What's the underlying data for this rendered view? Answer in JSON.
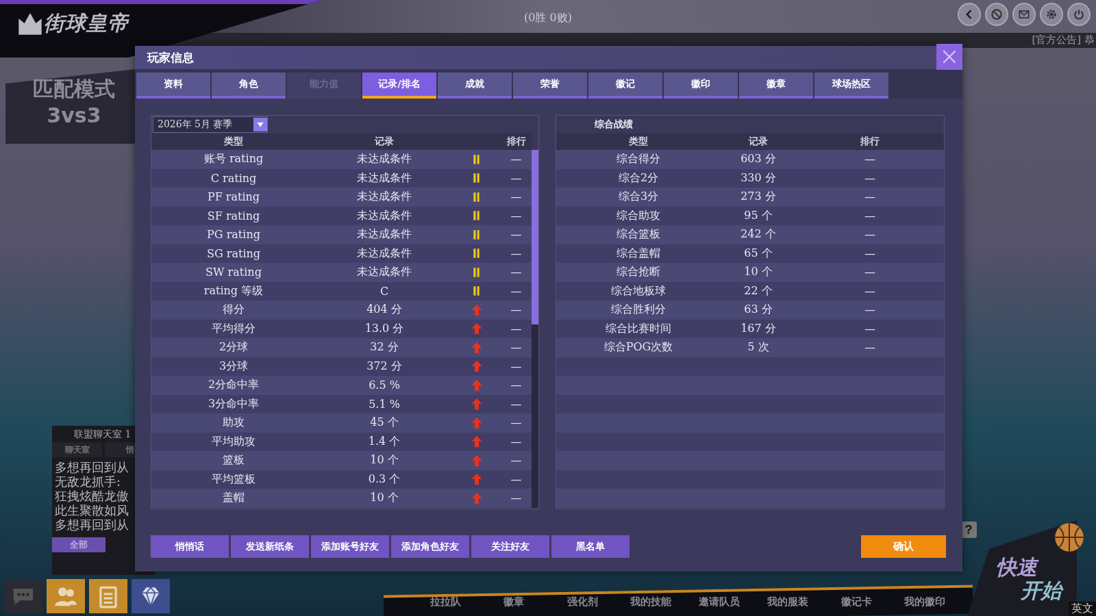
{
  "top_bar": {
    "logo": "街球皇帝",
    "record": "(0胜 0败)",
    "announcement": "[官方公告] 恭"
  },
  "mode": {
    "name": "匹配模式",
    "format": "3vs3"
  },
  "chat": {
    "title": "联盟聊天室 1",
    "tabs": [
      "聊天室",
      "悄"
    ],
    "messages": [
      "多想再回到从",
      "无敌龙抓手:",
      "狂拽炫酷龙傲",
      "此生聚散如风",
      "多想再回到从"
    ],
    "filter_button": "全部"
  },
  "dialog": {
    "title": "玩家信息",
    "tabs": [
      {
        "label": "资料",
        "selected": false,
        "disabled": false
      },
      {
        "label": "角色",
        "selected": false,
        "disabled": false
      },
      {
        "label": "能力值",
        "selected": false,
        "disabled": true
      },
      {
        "label": "记录/排名",
        "selected": true,
        "disabled": false
      },
      {
        "label": "成就",
        "selected": false,
        "disabled": false
      },
      {
        "label": "荣誉",
        "selected": false,
        "disabled": false
      },
      {
        "label": "徽记",
        "selected": false,
        "disabled": false
      },
      {
        "label": "徽印",
        "selected": false,
        "disabled": false
      },
      {
        "label": "徽章",
        "selected": false,
        "disabled": false
      },
      {
        "label": "球场热区",
        "selected": false,
        "disabled": false
      }
    ],
    "season": "2026年 5月 赛季",
    "season_table": {
      "columns": [
        "类型",
        "记录",
        "排行"
      ],
      "rows": [
        {
          "type": "账号 rating",
          "record": "未达成条件",
          "kind": "steady",
          "rank": "—"
        },
        {
          "type": "C rating",
          "record": "未达成条件",
          "kind": "steady",
          "rank": "—"
        },
        {
          "type": "PF rating",
          "record": "未达成条件",
          "kind": "steady",
          "rank": "—"
        },
        {
          "type": "SF rating",
          "record": "未达成条件",
          "kind": "steady",
          "rank": "—"
        },
        {
          "type": "PG rating",
          "record": "未达成条件",
          "kind": "steady",
          "rank": "—"
        },
        {
          "type": "SG rating",
          "record": "未达成条件",
          "kind": "steady",
          "rank": "—"
        },
        {
          "type": "SW rating",
          "record": "未达成条件",
          "kind": "steady",
          "rank": "—"
        },
        {
          "type": "rating 等级",
          "record": "C",
          "kind": "steady",
          "rank": "—"
        },
        {
          "type": "得分",
          "record": "404 分",
          "kind": "up",
          "rank": "—"
        },
        {
          "type": "平均得分",
          "record": "13.0 分",
          "kind": "up",
          "rank": "—"
        },
        {
          "type": "2分球",
          "record": "32 分",
          "kind": "up",
          "rank": "—"
        },
        {
          "type": "3分球",
          "record": "372 分",
          "kind": "up",
          "rank": "—"
        },
        {
          "type": "2分命中率",
          "record": "6.5 %",
          "kind": "up",
          "rank": "—"
        },
        {
          "type": "3分命中率",
          "record": "5.1 %",
          "kind": "up",
          "rank": "—"
        },
        {
          "type": "助攻",
          "record": "45 个",
          "kind": "up",
          "rank": "—"
        },
        {
          "type": "平均助攻",
          "record": "1.4 个",
          "kind": "up",
          "rank": "—"
        },
        {
          "type": "篮板",
          "record": "10 个",
          "kind": "up",
          "rank": "—"
        },
        {
          "type": "平均篮板",
          "record": "0.3 个",
          "kind": "up",
          "rank": "—"
        },
        {
          "type": "盖帽",
          "record": "10 个",
          "kind": "up",
          "rank": "—"
        }
      ]
    },
    "overall": {
      "title": "综合战绩",
      "columns": [
        "类型",
        "记录",
        "排行"
      ],
      "rows": [
        {
          "type": "综合得分",
          "record": "603 分",
          "rank": "—"
        },
        {
          "type": "综合2分",
          "record": "330 分",
          "rank": "—"
        },
        {
          "type": "综合3分",
          "record": "273 分",
          "rank": "—"
        },
        {
          "type": "综合助攻",
          "record": "95 个",
          "rank": "—"
        },
        {
          "type": "综合篮板",
          "record": "242 个",
          "rank": "—"
        },
        {
          "type": "综合盖帽",
          "record": "65 个",
          "rank": "—"
        },
        {
          "type": "综合抢断",
          "record": "10 个",
          "rank": "—"
        },
        {
          "type": "综合地板球",
          "record": "22 个",
          "rank": "—"
        },
        {
          "type": "综合胜利分",
          "record": "63 分",
          "rank": "—"
        },
        {
          "type": "综合比赛时间",
          "record": "167 分",
          "rank": "—"
        },
        {
          "type": "综合POG次数",
          "record": "5 次",
          "rank": "—"
        }
      ]
    },
    "actions": [
      "悄悄话",
      "发送新纸条",
      "添加账号好友",
      "添加角色好友",
      "关注好友",
      "黑名单"
    ],
    "confirm": "确认"
  },
  "bottom_menu": [
    "拉拉队",
    "徽章",
    "强化剂",
    "我的技能",
    "邀请队员",
    "我的服装",
    "徽记卡",
    "我的徽印"
  ],
  "quick_start": {
    "line1": "快速",
    "line2": "开始"
  },
  "language": "英文",
  "help_button": "?"
}
